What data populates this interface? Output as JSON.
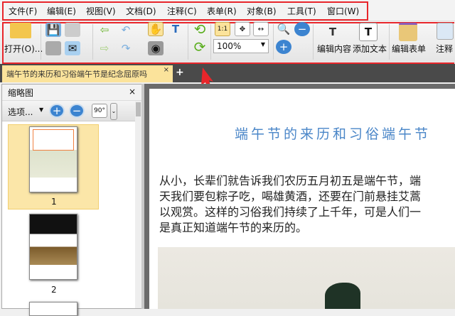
{
  "menu": [
    "文件(F)",
    "编辑(E)",
    "视图(V)",
    "文档(D)",
    "注释(C)",
    "表单(R)",
    "对象(B)",
    "工具(T)",
    "窗口(W)"
  ],
  "toolbar": {
    "open": "打开(O)...",
    "zoom": "100%",
    "edit_content": "编辑内容",
    "add_text": "添加文本",
    "edit_form": "编辑表单",
    "comment": "注释",
    "rotate_label": "90°"
  },
  "tab": {
    "title": "端午节的来历和习俗端午节是纪念屈原吗",
    "close": "×",
    "new": "+"
  },
  "panel": {
    "title": "缩略图",
    "close": "×",
    "options": "选项...",
    "pages": [
      "1",
      "2"
    ]
  },
  "document": {
    "title": "端午节的来历和习俗端午节",
    "lines": [
      "从小，长辈们就告诉我们农历五月初五是端午节，端",
      "天我们要包粽子吃，喝雄黄酒，还要在门前悬挂艾蒿",
      "以观赏。这样的习俗我们持续了上千年，可是人们一",
      "是真正知道端午节的来历的。"
    ]
  },
  "colors": {
    "highlight": "#e8262b",
    "title": "#4a86c8",
    "tab": "#fbe39b"
  }
}
